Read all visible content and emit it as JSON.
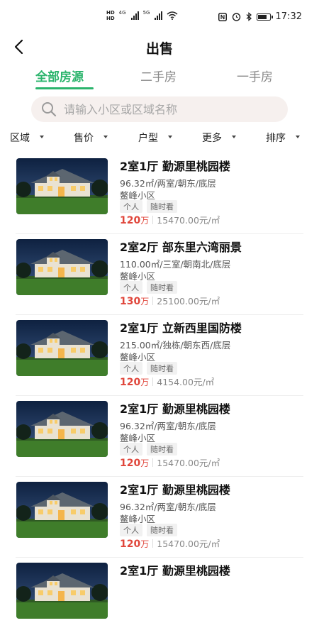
{
  "status_bar": {
    "time": "17:32",
    "signal_labels": [
      "4G",
      "5G"
    ],
    "battery_level": 0.8
  },
  "header": {
    "title": "出售"
  },
  "tabs": [
    {
      "label": "全部房源",
      "active": true
    },
    {
      "label": "二手房",
      "active": false
    },
    {
      "label": "一手房",
      "active": false
    }
  ],
  "search": {
    "placeholder": "请输入小区或区域名称"
  },
  "filters": [
    "区域",
    "售价",
    "户型",
    "更多",
    "排序"
  ],
  "listings": [
    {
      "title": "2室1厅 勤源里桃园楼",
      "spec": "96.32㎡/两室/朝东/底层",
      "community": "鳌峰小区",
      "tags": [
        "个人",
        "随时看"
      ],
      "price": "120",
      "price_unit": "万",
      "unit_price": "15470.00元/㎡"
    },
    {
      "title": "2室2厅 部东里六湾丽景",
      "spec": "110.00㎡/三室/朝南北/底层",
      "community": "鳌峰小区",
      "tags": [
        "个人",
        "随时看"
      ],
      "price": "130",
      "price_unit": "万",
      "unit_price": "25100.00元/㎡"
    },
    {
      "title": "2室1厅 立新西里国防楼",
      "spec": "215.00㎡/独栋/朝东西/底层",
      "community": "鳌峰小区",
      "tags": [
        "个人",
        "随时看"
      ],
      "price": "120",
      "price_unit": "万",
      "unit_price": "4154.00元/㎡"
    },
    {
      "title": "2室1厅 勤源里桃园楼",
      "spec": "96.32㎡/两室/朝东/底层",
      "community": "鳌峰小区",
      "tags": [
        "个人",
        "随时看"
      ],
      "price": "120",
      "price_unit": "万",
      "unit_price": "15470.00元/㎡"
    },
    {
      "title": "2室1厅 勤源里桃园楼",
      "spec": "96.32㎡/两室/朝东/底层",
      "community": "鳌峰小区",
      "tags": [
        "个人",
        "随时看"
      ],
      "price": "120",
      "price_unit": "万",
      "unit_price": "15470.00元/㎡"
    },
    {
      "title": "2室1厅 勤源里桃园楼",
      "spec": "",
      "community": "",
      "tags": [],
      "price": "",
      "price_unit": "",
      "unit_price": ""
    }
  ],
  "colors": {
    "accent": "#2bb46c",
    "price": "#e0463b",
    "search_bg": "#f6f0ee"
  }
}
